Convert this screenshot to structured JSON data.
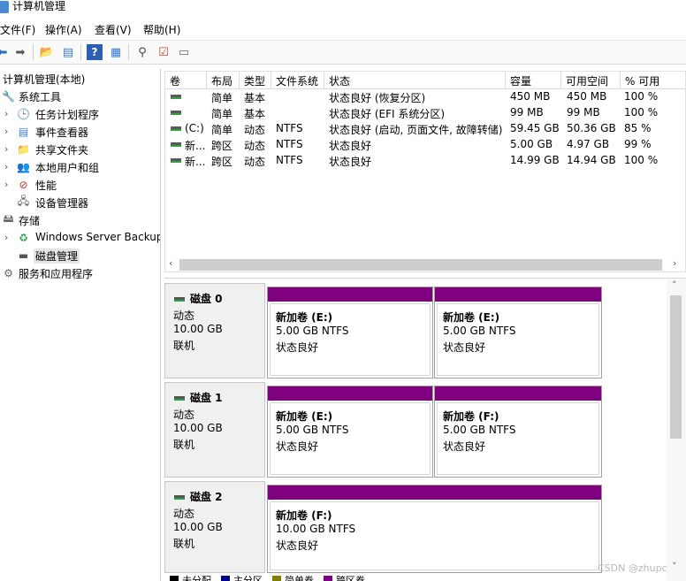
{
  "window": {
    "title": "计算机管理"
  },
  "menu": [
    "文件(F)",
    "操作(A)",
    "查看(V)",
    "帮助(H)"
  ],
  "colors": {
    "spanned_volume": "#800080",
    "unallocated": "#000000",
    "primary_partition": "#00008b",
    "simple_volume": "#808000"
  },
  "tree": {
    "root": "计算机管理(本地)",
    "system_tools": "系统工具",
    "task_scheduler": "任务计划程序",
    "event_viewer": "事件查看器",
    "shared_folders": "共享文件夹",
    "local_users": "本地用户和组",
    "performance": "性能",
    "device_manager": "设备管理器",
    "storage": "存储",
    "windows_backup": "Windows Server Backup",
    "disk_management": "磁盘管理",
    "services_apps": "服务和应用程序"
  },
  "table": {
    "headers": [
      "卷",
      "布局",
      "类型",
      "文件系统",
      "状态",
      "容量",
      "可用空间",
      "% 可用"
    ],
    "rows": [
      [
        "",
        "简单",
        "基本",
        "",
        "状态良好 (恢复分区)",
        "450 MB",
        "450 MB",
        "100 %"
      ],
      [
        "",
        "简单",
        "基本",
        "",
        "状态良好 (EFI 系统分区)",
        "99 MB",
        "99 MB",
        "100 %"
      ],
      [
        "(C:)",
        "简单",
        "动态",
        "NTFS",
        "状态良好 (启动, 页面文件, 故障转储)",
        "59.45 GB",
        "50.36 GB",
        "85 %"
      ],
      [
        "新...",
        "跨区",
        "动态",
        "NTFS",
        "状态良好",
        "5.00 GB",
        "4.97 GB",
        "99 %"
      ],
      [
        "新...",
        "跨区",
        "动态",
        "NTFS",
        "状态良好",
        "14.99 GB",
        "14.94 GB",
        "100 %"
      ]
    ]
  },
  "disks": [
    {
      "name": "磁盘 0",
      "type": "动态",
      "size": "10.00 GB",
      "status": "联机",
      "volumes": [
        {
          "name": "新加卷  (E:)",
          "size": "5.00 GB NTFS",
          "status": "状态良好"
        },
        {
          "name": "新加卷  (E:)",
          "size": "5.00 GB NTFS",
          "status": "状态良好"
        }
      ]
    },
    {
      "name": "磁盘 1",
      "type": "动态",
      "size": "10.00 GB",
      "status": "联机",
      "volumes": [
        {
          "name": "新加卷  (E:)",
          "size": "5.00 GB NTFS",
          "status": "状态良好"
        },
        {
          "name": "新加卷  (F:)",
          "size": "5.00 GB NTFS",
          "status": "状态良好"
        }
      ]
    },
    {
      "name": "磁盘 2",
      "type": "动态",
      "size": "10.00 GB",
      "status": "联机",
      "volumes": [
        {
          "name": "新加卷  (F:)",
          "size": "10.00 GB NTFS",
          "status": "状态良好"
        }
      ]
    }
  ],
  "legend": [
    "未分配",
    "主分区",
    "简单卷",
    "跨区卷"
  ],
  "watermark": "CSDN @zhupc"
}
